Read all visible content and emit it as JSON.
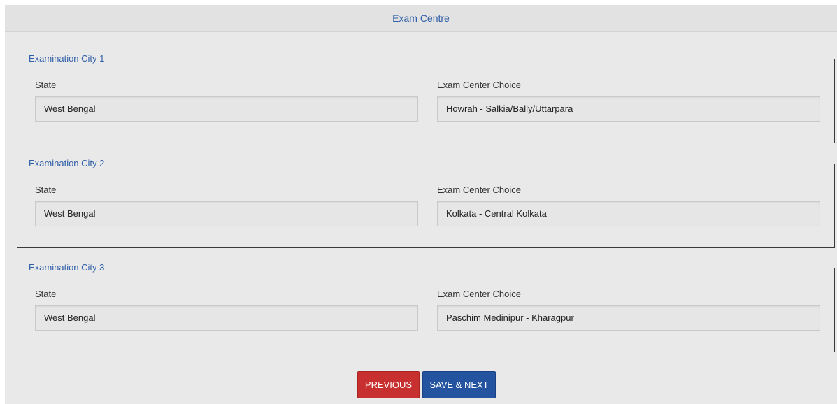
{
  "header": {
    "title": "Exam Centre"
  },
  "cities": [
    {
      "legend": "Examination City 1",
      "state_label": "State",
      "state_value": "West Bengal",
      "center_label": "Exam Center Choice",
      "center_value": "Howrah - Salkia/Bally/Uttarpara"
    },
    {
      "legend": "Examination City 2",
      "state_label": "State",
      "state_value": "West Bengal",
      "center_label": "Exam Center Choice",
      "center_value": "Kolkata - Central Kolkata"
    },
    {
      "legend": "Examination City 3",
      "state_label": "State",
      "state_value": "West Bengal",
      "center_label": "Exam Center Choice",
      "center_value": "Paschim Medinipur - Kharagpur"
    }
  ],
  "buttons": {
    "previous_label": "PREVIOUS",
    "save_next_label": "SAVE & NEXT"
  },
  "colors": {
    "accent_text": "#2f5fa8",
    "previous_button": "#c8302f",
    "save_next_button": "#2453a0"
  }
}
